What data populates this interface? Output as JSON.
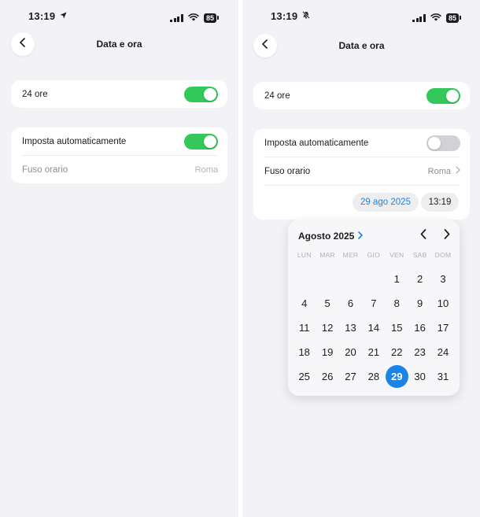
{
  "colors": {
    "accent": "#1a84e8",
    "toggle_on": "#34c759",
    "toggle_off": "#d1d1d6",
    "background": "#f2f2f7"
  },
  "left": {
    "status": {
      "time": "13:19",
      "time_icon": "location-arrow-icon",
      "battery": "85"
    },
    "nav": {
      "title": "Data e ora"
    },
    "settings": {
      "hour24": {
        "label": "24 ore",
        "on": true
      },
      "auto": {
        "label": "Imposta automaticamente",
        "on": true
      },
      "timezone": {
        "label": "Fuso orario",
        "value": "Roma"
      }
    }
  },
  "right": {
    "status": {
      "time": "13:19",
      "time_icon": "bell-slash-icon",
      "battery": "85"
    },
    "nav": {
      "title": "Data e ora"
    },
    "settings": {
      "hour24": {
        "label": "24 ore",
        "on": true
      },
      "auto": {
        "label": "Imposta automaticamente",
        "on": false
      },
      "timezone": {
        "label": "Fuso orario",
        "value": "Roma"
      },
      "date_value": "29 ago 2025",
      "time_value": "13:19"
    },
    "calendar": {
      "month_label": "Agosto 2025",
      "weekdays": [
        "LUN",
        "MAR",
        "MER",
        "GIO",
        "VEN",
        "SAB",
        "DOM"
      ],
      "first_weekday_index": 4,
      "days_in_month": 31,
      "selected_day": 29
    }
  }
}
